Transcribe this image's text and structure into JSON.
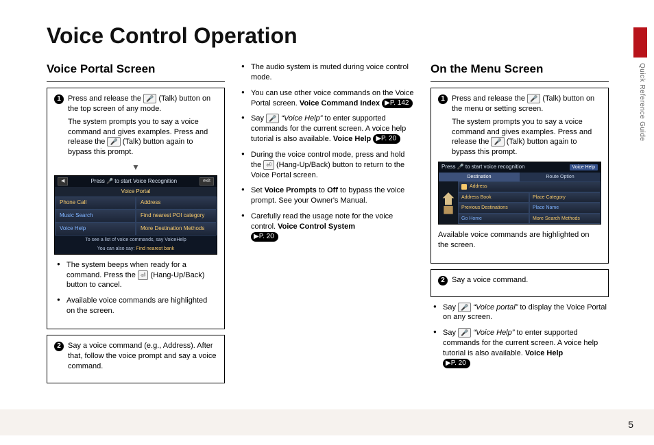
{
  "page": {
    "title": "Voice Control Operation",
    "number": "5",
    "side_label": "Quick Reference Guide"
  },
  "section_a": {
    "heading": "Voice Portal Screen",
    "step1_a": "Press and release the ",
    "step1_b": " (Talk) button on the top screen of any mode.",
    "step1_c": "The system prompts you to say a voice command and gives examples. Press and release the ",
    "step1_d": " (Talk) button again to bypass this prompt.",
    "arrow": "▼",
    "screen": {
      "topbar_text": "Press 🎤 to start Voice Recognition",
      "exit": "exit",
      "title": "Voice Portal",
      "items": [
        "Phone Call",
        "Address",
        "Music Search",
        "Find nearest POI category",
        "Voice Help",
        "More Destination Methods"
      ],
      "sub1": "To see a list of voice commands, say VoiceHelp",
      "sub2_a": "You can also say: ",
      "sub2_b": "Find nearest bank"
    },
    "bul1_a": "The system beeps when ready for a command. Press the ",
    "bul1_b": " (Hang-Up/Back) button to cancel.",
    "bul2": "Available voice commands are highlighted on the screen.",
    "step2": "Say a voice command (e.g., Address). After that, follow the voice prompt and say a voice command."
  },
  "section_b": {
    "bul1": "The audio system is muted during voice control mode.",
    "bul2_a": "You can use other voice commands on the Voice Portal screen. ",
    "bul2_b": "Voice Command Index",
    "bul2_ref": "▶P. 142",
    "bul3_a": "Say ",
    "bul3_q": "“Voice Help”",
    "bul3_b": " to enter supported commands for the current screen. A voice help tutorial is also available. ",
    "bul3_c": "Voice Help",
    "bul3_ref": "▶P. 20",
    "bul4_a": "During the voice control mode, press and hold the ",
    "bul4_b": " (Hang-Up/Back) button to return to the Voice Portal screen.",
    "bul5_a": "Set ",
    "bul5_b": "Voice Prompts",
    "bul5_c": " to ",
    "bul5_d": "Off",
    "bul5_e": " to bypass the voice prompt. See your Owner's Manual.",
    "bul6_a": "Carefully read the usage note for the voice control. ",
    "bul6_b": "Voice Control System",
    "bul6_ref": "▶P. 20"
  },
  "section_c": {
    "heading": "On the Menu Screen",
    "step1_a": "Press and release the ",
    "step1_b": " (Talk) button on the menu or setting screen.",
    "step1_c": "The system prompts you to say a voice command and gives examples. Press and release the ",
    "step1_d": " (Talk) button again to bypass this prompt.",
    "screen": {
      "topbar_text": "Press 🎤 to start voice recognition",
      "voicehelp": "Voice Help",
      "tab1": "Destination",
      "tab2": "Route Option",
      "items": [
        "Address",
        "Address Book",
        "Place Category",
        "Previous Destinations",
        "Place Name",
        "Go Home",
        "More Search Methods"
      ]
    },
    "caption": "Available voice commands are highlighted on the screen.",
    "step2": "Say a voice command.",
    "bul1_a": "Say ",
    "bul1_q": "“Voice portal”",
    "bul1_b": " to display the Voice Portal on any screen.",
    "bul2_a": "Say ",
    "bul2_q": "“Voice Help”",
    "bul2_b": " to enter supported commands for the current screen. A voice help tutorial is also available. ",
    "bul2_c": "Voice Help",
    "bul2_ref": "▶P. 20"
  },
  "icons": {
    "talk": "🎤",
    "hangup": "⏎"
  }
}
